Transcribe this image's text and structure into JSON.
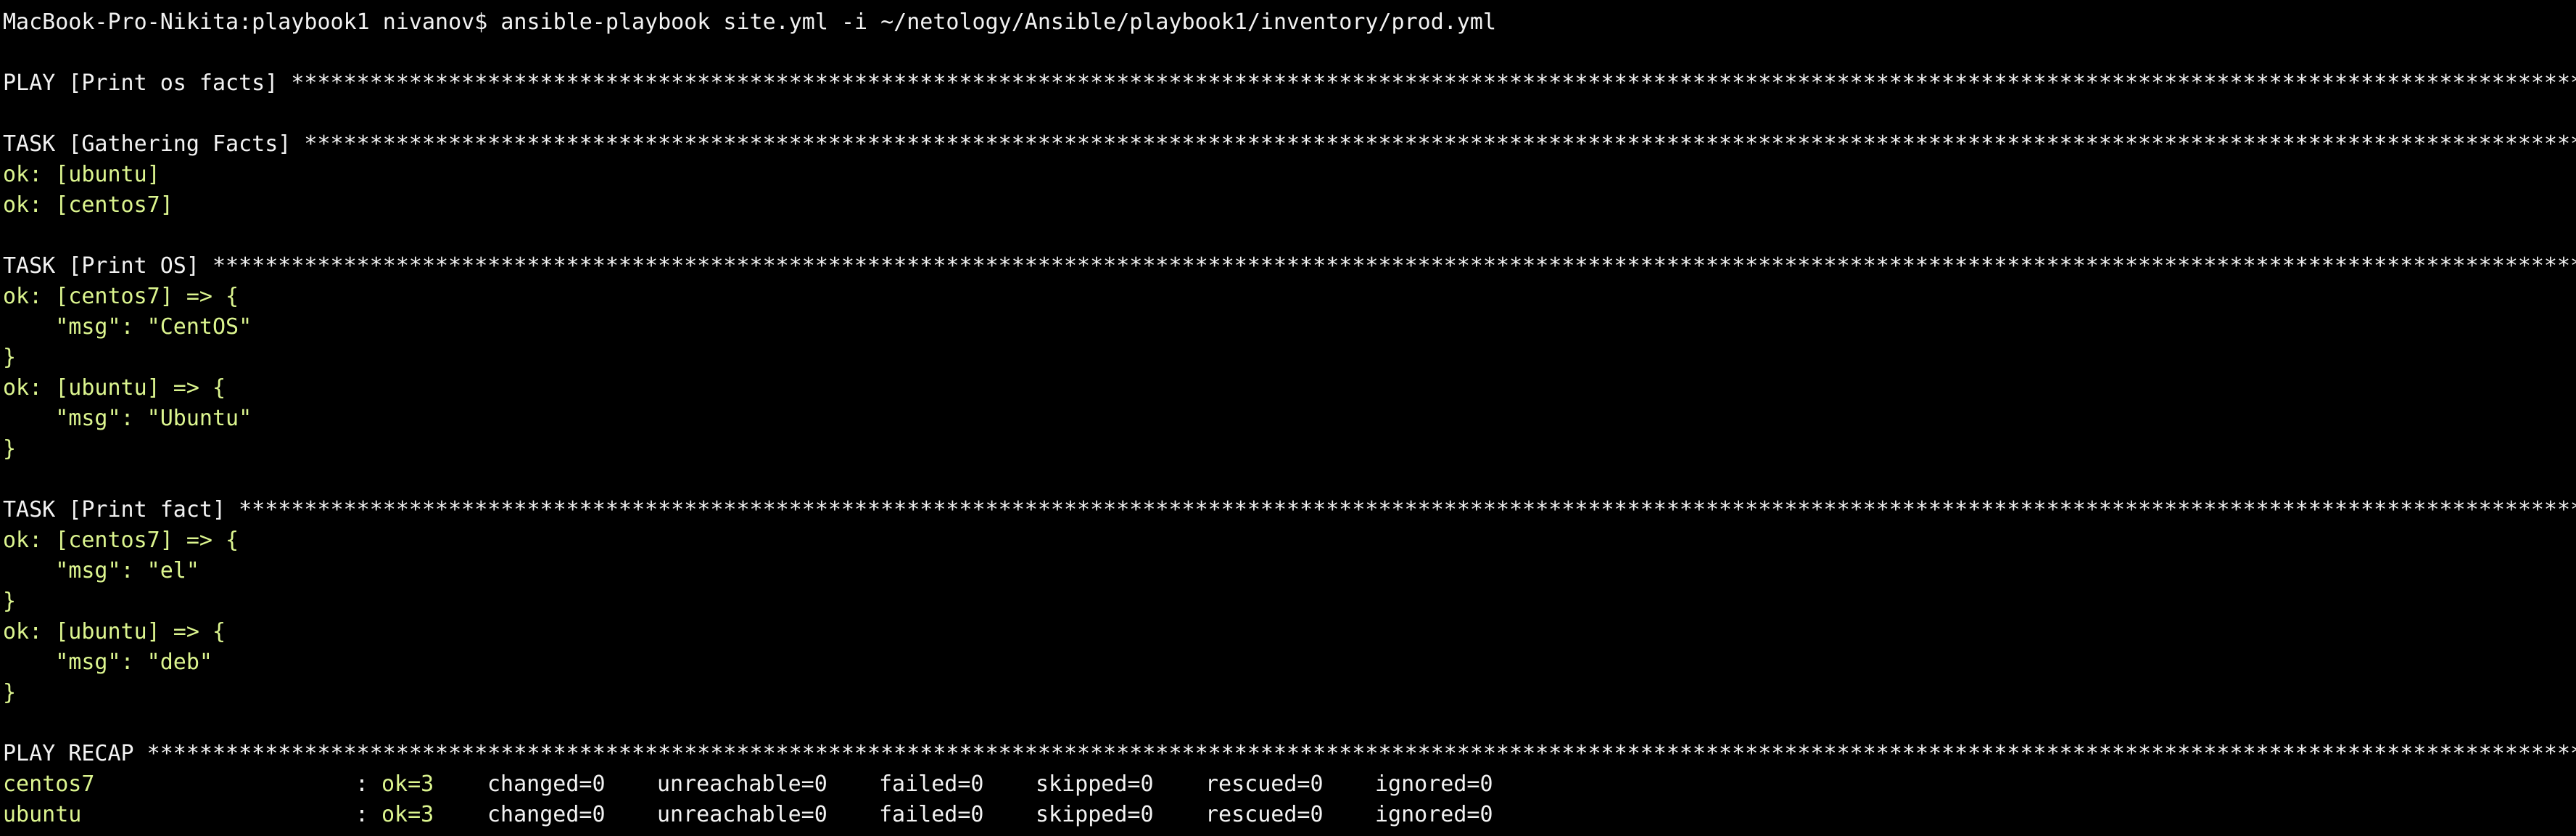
{
  "colors": {
    "background": "#000000",
    "default_text": "#f2f2f2",
    "ok_text": "#dcf58f"
  },
  "prompt": {
    "text": "MacBook-Pro-Nikita:playbook1 nivanov$ ansible-playbook site.yml -i ~/netology/Ansible/playbook1/inventory/prod.yml"
  },
  "play_header": "PLAY [Print os facts] ************************************************************************************************************************************************************************************************************************************",
  "tasks": [
    {
      "header": "TASK [Gathering Facts] ***********************************************************************************************************************************************************************************************************************************",
      "lines": [
        "ok: [ubuntu]",
        "ok: [centos7]"
      ]
    },
    {
      "header": "TASK [Print OS] *****************************************************************************************************************************************************************************************************************************************",
      "lines": [
        "ok: [centos7] => {",
        "    \"msg\": \"CentOS\"",
        "}",
        "ok: [ubuntu] => {",
        "    \"msg\": \"Ubuntu\"",
        "}"
      ]
    },
    {
      "header": "TASK [Print fact] ***************************************************************************************************************************************************************************************************************************************",
      "lines": [
        "ok: [centos7] => {",
        "    \"msg\": \"el\"",
        "}",
        "ok: [ubuntu] => {",
        "    \"msg\": \"deb\"",
        "}"
      ]
    }
  ],
  "recap": {
    "header": "PLAY RECAP **********************************************************************************************************************************************************************************************************************************************",
    "rows": [
      {
        "host": "centos7",
        "separator": ":",
        "ok": "ok=3",
        "changed": "changed=0",
        "unreachable": "unreachable=0",
        "failed": "failed=0",
        "skipped": "skipped=0",
        "rescued": "rescued=0",
        "ignored": "ignored=0"
      },
      {
        "host": "ubuntu",
        "separator": ":",
        "ok": "ok=3",
        "changed": "changed=0",
        "unreachable": "unreachable=0",
        "failed": "failed=0",
        "skipped": "skipped=0",
        "rescued": "rescued=0",
        "ignored": "ignored=0"
      }
    ]
  }
}
